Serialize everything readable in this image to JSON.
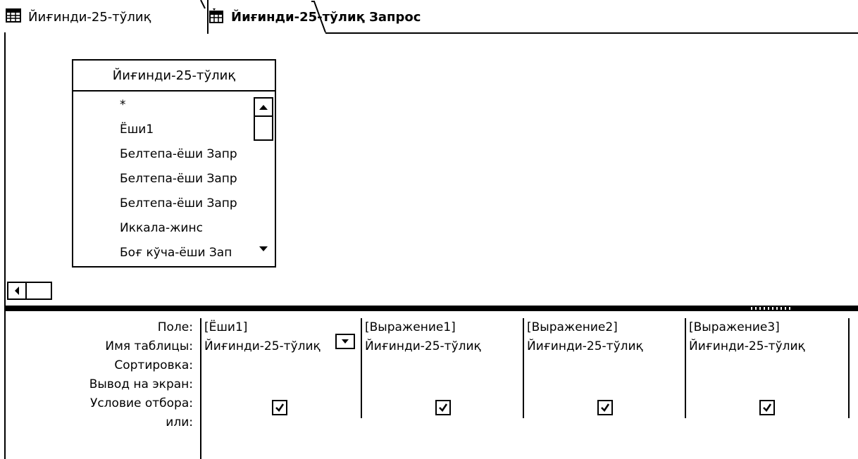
{
  "tabs": [
    {
      "label": "Йиғинди-25-тўлиқ",
      "icon": "table-icon",
      "active": false
    },
    {
      "label": "Йиғинди-25-тўлиқ Запрос",
      "icon": "query-icon",
      "active": true
    }
  ],
  "table_box": {
    "title": "Йиғинди-25-тўлиқ",
    "fields": [
      "*",
      "Ёши1",
      "Белтепа-ёши Запр",
      "Белтепа-ёши Запр",
      "Белтепа-ёши Запр",
      "Иккала-жинс",
      "Боғ кўча-ёши Зап"
    ]
  },
  "grid": {
    "row_labels": {
      "field": "Поле:",
      "table": "Имя таблицы:",
      "sort": "Сортировка:",
      "show": "Вывод на экран:",
      "criteria": "Условие отбора:",
      "or": "или:"
    },
    "columns": [
      {
        "field": "[Ёши1]",
        "table": "Йиғинди-25-тўлиқ",
        "show": true
      },
      {
        "field": "[Выражение1]",
        "table": "Йиғинди-25-тўлиқ",
        "show": true
      },
      {
        "field": "[Выражение2]",
        "table": "Йиғинди-25-тўлиқ",
        "show": true
      },
      {
        "field": "[Выражение3]",
        "table": "Йиғинди-25-тўлиқ",
        "show": true
      }
    ]
  }
}
